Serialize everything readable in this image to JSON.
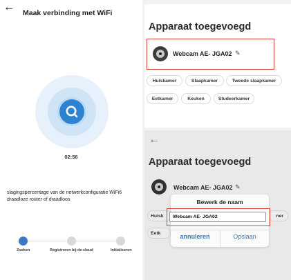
{
  "wifi_screen": {
    "title": "Maak verbinding met WiFi",
    "timer": "02:56",
    "description": "slagingspercentage van de netwerkconfiguratie WiFi6 draadloze router of draadloos",
    "steps": [
      {
        "label": "Zoeken",
        "color": "#3b79c7"
      },
      {
        "label": "Registreren bij de cloud",
        "color": "#d9d9d9"
      },
      {
        "label": "Initialiseren",
        "color": "#d9d9d9"
      }
    ],
    "accent": "#2e83d1"
  },
  "added_screen": {
    "title": "Apparaat toegevoegd",
    "device_name": "Webcam AE- JGA02",
    "rooms": [
      "Huiskamer",
      "Slaapkamer",
      "Tweede slaapkamer",
      "Eetkamer",
      "Keuken",
      "Studeerkamer"
    ]
  },
  "edit_screen": {
    "title": "Apparaat toegevoegd",
    "device_name": "Webcam AE- JGA02",
    "partial_rooms": [
      "Huisk",
      "ner",
      "Eetk"
    ],
    "dialog": {
      "title": "Bewerk de naam",
      "input_value": "Webcam AE- JGA02",
      "cancel": "annuleren",
      "confirm": "Opslaan"
    }
  },
  "highlight_color": "#d6403a"
}
